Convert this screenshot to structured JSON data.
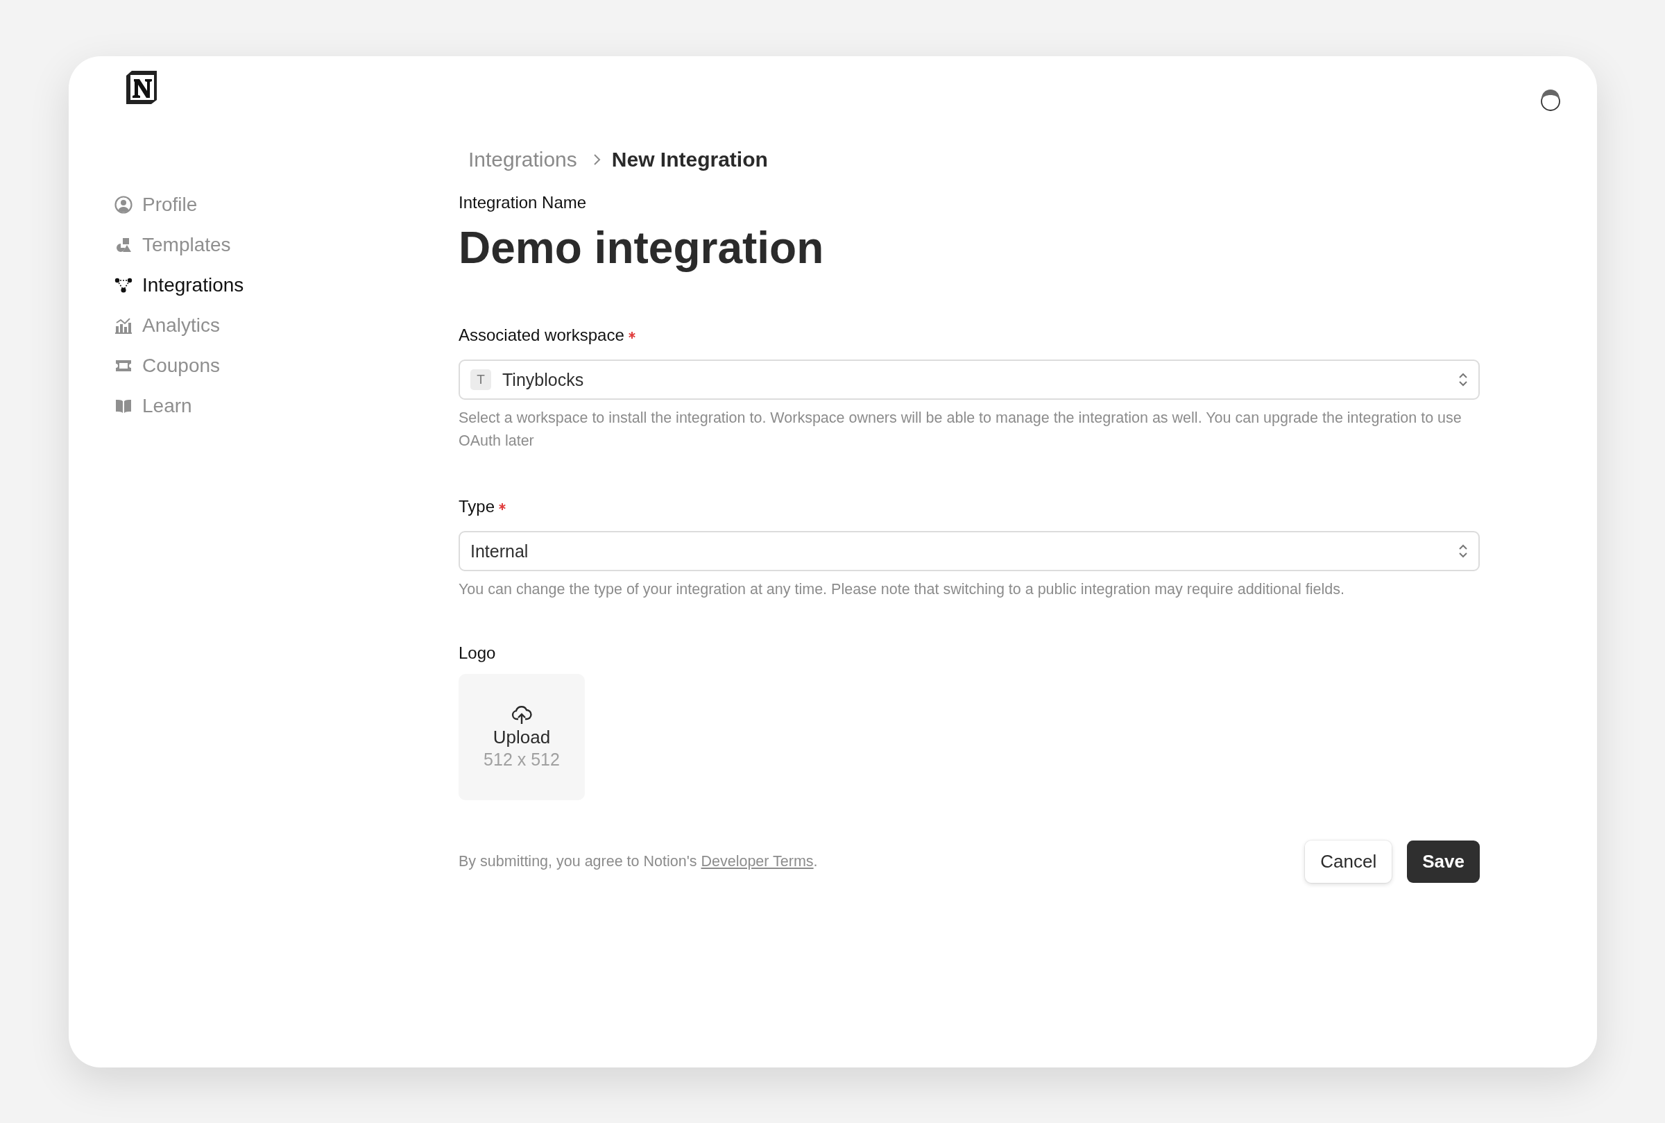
{
  "sidebar": {
    "items": [
      {
        "label": "Profile",
        "selected": false
      },
      {
        "label": "Templates",
        "selected": false
      },
      {
        "label": "Integrations",
        "selected": true
      },
      {
        "label": "Analytics",
        "selected": false
      },
      {
        "label": "Coupons",
        "selected": false
      },
      {
        "label": "Learn",
        "selected": false
      }
    ]
  },
  "breadcrumb": [
    {
      "label": "Integrations",
      "current": false
    },
    {
      "label": "New Integration",
      "current": true
    }
  ],
  "name_label": "Integration Name",
  "title": "Demo integration",
  "fields": [
    {
      "label": "Associated workspace",
      "required": true,
      "badge": "T",
      "value": "Tinyblocks",
      "help": "Select a workspace to install the integration to. Workspace owners will be able to manage the integration as well. You can upgrade the integration to use OAuth later"
    },
    {
      "label": "Type",
      "required": true,
      "value": "Internal",
      "help": "You can change the type of your integration at any time. Please note that switching to a public integration may require additional fields."
    }
  ],
  "logo": {
    "label": "Logo",
    "upload": "Upload",
    "size": "512 x 512"
  },
  "footer": {
    "text": "By submitting, you agree to Notion's ",
    "link": "Developer Terms",
    "end": "."
  },
  "buttons": [
    {
      "label": "Cancel",
      "kind": "secondary"
    },
    {
      "label": "Save",
      "kind": "primary"
    }
  ]
}
